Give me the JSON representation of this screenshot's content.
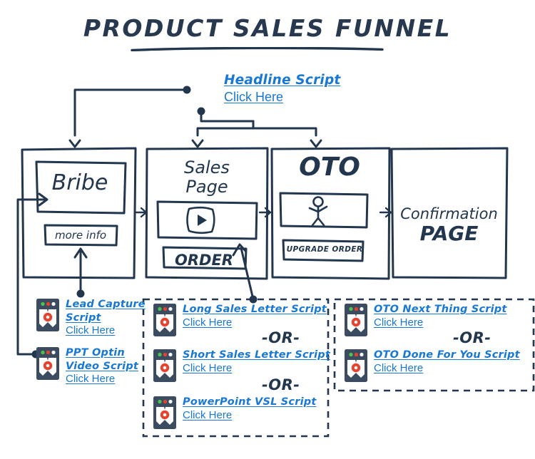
{
  "page": {
    "title": "PRODUCT SALES FUNNEL",
    "background": "#ffffff",
    "ink_color": "#22364d",
    "link_color": "#1878d4",
    "icon_body_color": "#3c4c60",
    "icon_gear_color": "#e8422e"
  },
  "stages": [
    {
      "id": "bribe",
      "label": "Bribe",
      "button_label": "more info"
    },
    {
      "id": "sales-page",
      "label": "Sales\nPage",
      "media": "video-player",
      "button_label": "ORDER"
    },
    {
      "id": "oto",
      "label": "OTO",
      "media": "stick-figure",
      "button_label": "UPGRADE ORDER"
    },
    {
      "id": "confirmation",
      "label_line1": "Confirmation",
      "label_line2": "PAGE"
    }
  ],
  "links": {
    "headline": {
      "title": "Headline Script",
      "action": "Click Here"
    },
    "lead_capture": {
      "title": "Lead Capture\nScript",
      "action": "Click Here"
    },
    "ppt_optin": {
      "title": "PPT Optin\nVideo Script",
      "action": "Click Here"
    },
    "long_sales_letter": {
      "title": "Long Sales Letter Script",
      "action": "Click Here"
    },
    "short_sales_letter": {
      "title": "Short Sales Letter Script",
      "action": "Click Here"
    },
    "powerpoint_vsl": {
      "title": "PowerPoint VSL Script",
      "action": "Click Here"
    },
    "oto_next_thing": {
      "title": "OTO Next Thing Script",
      "action": "Click Here"
    },
    "oto_done_for_you": {
      "title": "OTO Done For You Script",
      "action": "Click Here"
    }
  },
  "separators": {
    "or": "-OR-"
  },
  "icon_names": {
    "script": "script-document-icon",
    "play": "play-button-icon",
    "person": "stick-figure-icon"
  }
}
